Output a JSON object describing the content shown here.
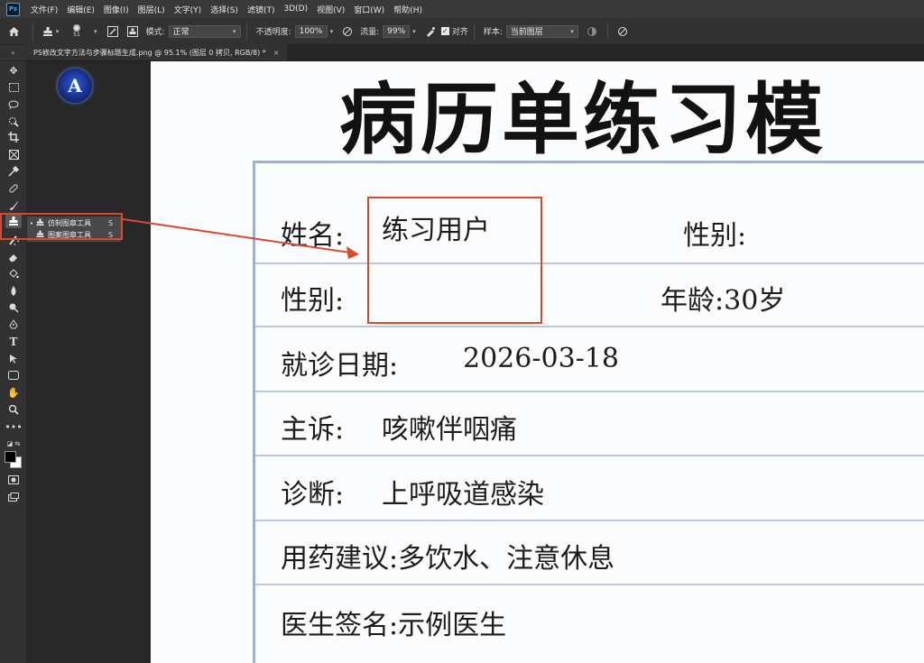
{
  "app": {
    "logo_text": "Ps",
    "menu": [
      "文件(F)",
      "编辑(E)",
      "图像(I)",
      "图层(L)",
      "文字(Y)",
      "选择(S)",
      "滤镜(T)",
      "3D(D)",
      "视图(V)",
      "窗口(W)",
      "帮助(H)"
    ]
  },
  "options_bar": {
    "brush_size": "51",
    "mode_label": "模式:",
    "mode_value": "正常",
    "opacity_label": "不透明度:",
    "opacity_value": "100%",
    "flow_label": "流量:",
    "flow_value": "99%",
    "align_label": "对齐",
    "align_checked": true,
    "sample_label": "样本:",
    "sample_value": "当前图层"
  },
  "document_tab": {
    "title": "PS修改文字方法与步骤标题生成.png @ 95.1% (图层 0 拷贝, RGB/8) *",
    "close": "×"
  },
  "app_overlay_logo": "A",
  "tool_flyout": {
    "items": [
      {
        "name": "仿制图章工具",
        "key": "S",
        "active": true
      },
      {
        "name": "图案图章工具",
        "key": "S",
        "active": false
      }
    ]
  },
  "document": {
    "title": "病历单练习模",
    "fields": {
      "name_label": "姓名:",
      "name_value": "练习用户",
      "gender_label_right": "性别:",
      "gender_label": "性别:",
      "age": "年龄:30岁",
      "visit_date_label": "就诊日期:",
      "visit_date_value": "2026-03-18",
      "complaint_label": "主诉:",
      "complaint_value": "咳嗽伴咽痛",
      "diagnosis_label": "诊断:",
      "diagnosis_value": "上呼吸道感染",
      "advice": "用药建议:多饮水、注意休息",
      "doctor": "医生签名:示例医生"
    }
  },
  "colors": {
    "annotation": "#d84a2c",
    "ps_bg": "#323232",
    "form_line": "#b9c8da"
  }
}
